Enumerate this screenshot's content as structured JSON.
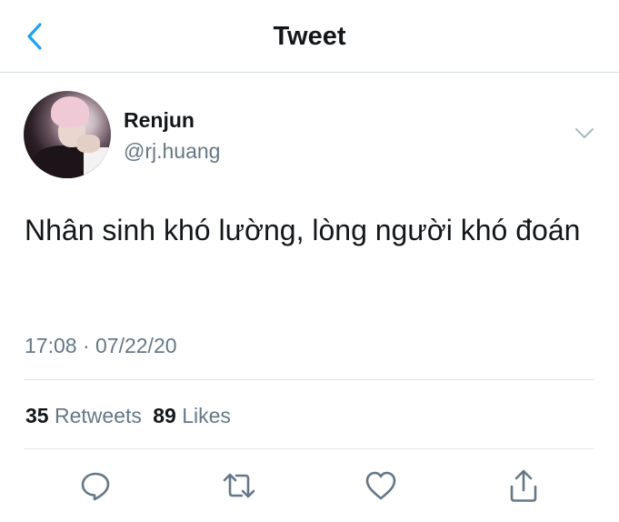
{
  "header": {
    "title": "Tweet",
    "back_icon": "chevron-left-icon"
  },
  "author": {
    "name": "Renjun",
    "handle": "@rj.huang"
  },
  "tweet": {
    "text": "Nhân sinh khó lường, lòng người khó đoán",
    "timestamp": "17:08 · 07/22/20"
  },
  "stats": {
    "retweets_count": "35",
    "retweets_label": "Retweets",
    "likes_count": "89",
    "likes_label": "Likes"
  },
  "actions": [
    "reply-icon",
    "retweet-icon",
    "like-icon",
    "share-icon"
  ],
  "colors": {
    "accent": "#1da1f2",
    "text": "#14171a",
    "secondary": "#657786",
    "divider": "#e1e8ed"
  }
}
